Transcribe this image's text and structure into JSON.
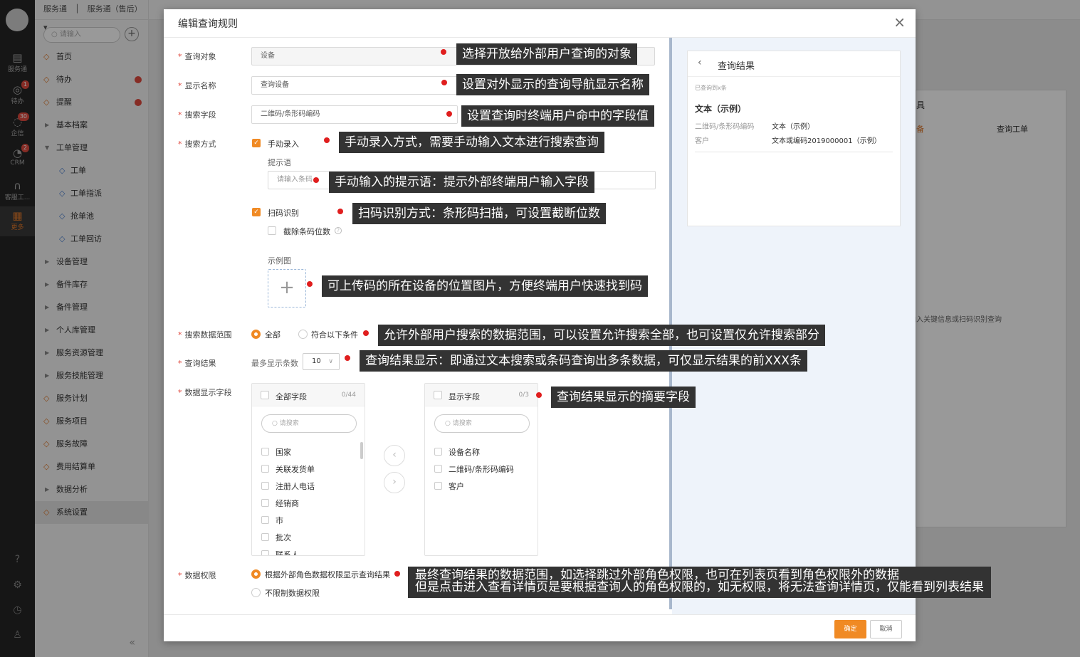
{
  "app": {
    "topbar_app": "服务通",
    "topbar_module": "服务通（售后）",
    "search_placeholder": "请输入"
  },
  "rail": {
    "items": [
      {
        "icon": "service-icon",
        "label": "服务通"
      },
      {
        "icon": "todo-icon",
        "label": "待办",
        "badge": "1"
      },
      {
        "icon": "chat-icon",
        "label": "企信",
        "badge": "30"
      },
      {
        "icon": "crm-icon",
        "label": "CRM",
        "badge": "2"
      },
      {
        "icon": "headset-icon",
        "label": "客服工..."
      },
      {
        "icon": "grid-icon",
        "label": "更多"
      }
    ]
  },
  "sidebar": {
    "items": [
      {
        "label": "首页",
        "icon": "home-icon"
      },
      {
        "label": "待办",
        "icon": "check-icon",
        "dot": true
      },
      {
        "label": "提醒",
        "icon": "bell-icon",
        "dot": true
      },
      {
        "label": "基本档案",
        "expand": true
      },
      {
        "label": "工单管理",
        "expand": true,
        "open": true
      },
      {
        "label": "工单",
        "sub": true,
        "icon": "doc-icon"
      },
      {
        "label": "工单指派",
        "sub": true,
        "icon": "doc-icon"
      },
      {
        "label": "抢单池",
        "sub": true,
        "icon": "doc-icon"
      },
      {
        "label": "工单回访",
        "sub": true,
        "icon": "doc-icon"
      },
      {
        "label": "设备管理",
        "expand": true
      },
      {
        "label": "备件库存",
        "expand": true
      },
      {
        "label": "备件管理",
        "expand": true
      },
      {
        "label": "个人库管理",
        "expand": true
      },
      {
        "label": "服务资源管理",
        "expand": true
      },
      {
        "label": "服务技能管理",
        "expand": true
      },
      {
        "label": "服务计划",
        "icon": "plan-icon"
      },
      {
        "label": "服务项目",
        "icon": "flag-icon"
      },
      {
        "label": "服务故障",
        "icon": "fault-icon"
      },
      {
        "label": "费用结算单",
        "icon": "bill-icon"
      },
      {
        "label": "数据分析",
        "expand": true
      },
      {
        "label": "系统设置",
        "icon": "gear-icon",
        "active": true
      }
    ]
  },
  "background": {
    "panel_title": "具",
    "tab_partial": "备",
    "tab_workorder": "查询工单",
    "hint": "输入关键信息或扫码识别查询"
  },
  "modal": {
    "title": "编辑查询规则",
    "close": "×",
    "fields": {
      "query_object": {
        "label": "查询对象",
        "value": "设备"
      },
      "display_name": {
        "label": "显示名称",
        "value": "查询设备"
      },
      "search_field": {
        "label": "搜索字段",
        "value": "二维码/条形码编码"
      },
      "search_method": {
        "label": "搜索方式",
        "manual": "手动录入",
        "prompt_label": "提示语",
        "prompt_value": "请输入条码",
        "scan": "扫码识别",
        "truncate": "截除条码位数",
        "example_label": "示例图"
      },
      "data_scope": {
        "label": "搜索数据范围",
        "all": "全部",
        "conditional": "符合以下条件"
      },
      "query_result": {
        "label": "查询结果",
        "max_label": "最多显示条数",
        "max_value": "10"
      },
      "data_fields": {
        "label": "数据显示字段",
        "left_title": "全部字段",
        "left_count": "0/44",
        "right_title": "显示字段",
        "right_count": "0/3",
        "search_placeholder": "请搜索",
        "left_items": [
          "国家",
          "关联发货单",
          "注册人电话",
          "经销商",
          "市",
          "批次",
          "联系人"
        ],
        "right_items": [
          "设备名称",
          "二维码/条形码编码",
          "客户"
        ],
        "arrow_left": "‹",
        "arrow_right": "›"
      },
      "data_permission": {
        "label": "数据权限",
        "option1": "根据外部角色数据权限显示查询结果",
        "option2": "不限制数据权限"
      }
    },
    "preview": {
      "back": "‹",
      "title": "查询结果",
      "count_text": "已查询到x条",
      "result_title": "文本（示例）",
      "rows": [
        {
          "key": "二维码/条形码编码",
          "value": "文本（示例）"
        },
        {
          "key": "客户",
          "value": "文本或编码2019000001（示例）"
        }
      ]
    },
    "footer": {
      "ok": "确定",
      "cancel": "取消"
    }
  },
  "annotations": [
    "选择开放给外部用户查询的对象",
    "设置对外显示的查询导航显示名称",
    "设置查询时终端用户命中的字段值",
    "手动录入方式，需要手动输入文本进行搜索查询",
    "手动输入的提示语：提示外部终端用户输入字段",
    "扫码识别方式：条形码扫描，可设置截断位数",
    "可上传码的所在设备的位置图片，方便终端用户快速找到码",
    "允许外部用户搜索的数据范围，可以设置允许搜索全部，也可设置仅允许搜索部分",
    "查询结果显示：即通过文本搜索或条码查询出多条数据，可仅显示结果的前XXX条",
    "查询结果显示的摘要字段",
    "最终查询结果的数据范围，如选择跳过外部角色权限，也可在列表页看到角色权限外的数据",
    "但是点击进入查看详情页是要根据查询人的角色权限的，如无权限，将无法查询详情页，仅能看到列表结果"
  ],
  "colors": {
    "accent": "#f08a24",
    "annotation_bg": "#333333",
    "annotation_dot": "#e01e1e",
    "rail": "#262626"
  }
}
